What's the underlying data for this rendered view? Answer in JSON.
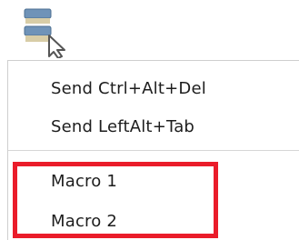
{
  "toolbar": {
    "button_icon": "multi-window-icon",
    "cursor_icon": "arrow-cursor-icon"
  },
  "menu": {
    "items": [
      {
        "label": "Send Ctrl+Alt+Del"
      },
      {
        "label": "Send LeftAlt+Tab"
      },
      {
        "label": "Macro 1"
      },
      {
        "label": "Macro 2"
      }
    ]
  },
  "highlight": {
    "color": "#ea1c2a",
    "target": "macro-group"
  },
  "colors": {
    "icon_blue": "#6f93b8",
    "icon_tan": "#d8cda7",
    "menu_text": "#1d1d1d",
    "separator": "#d6d6d6"
  }
}
